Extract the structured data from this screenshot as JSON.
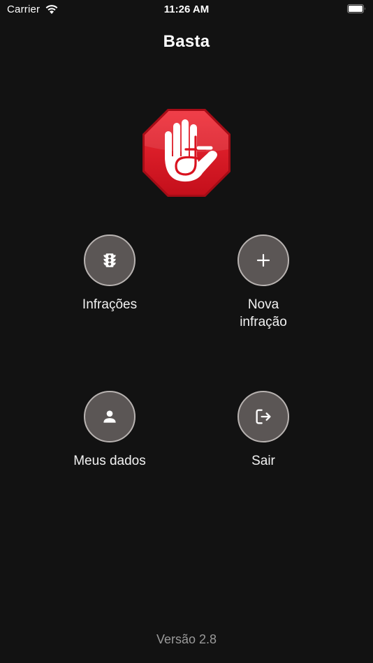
{
  "status_bar": {
    "carrier": "Carrier",
    "time": "11:26 AM"
  },
  "header": {
    "title": "Basta"
  },
  "logo": {
    "icon": "stop-hand-logo",
    "colors": {
      "octagon": "#d9121f",
      "border": "#b00d18",
      "hand": "#ffffff"
    }
  },
  "menu": {
    "items": [
      {
        "label": "Infrações",
        "icon": "traffic-light-icon"
      },
      {
        "label": "Nova infração",
        "icon": "plus-icon"
      },
      {
        "label": "Meus dados",
        "icon": "person-icon"
      },
      {
        "label": "Sair",
        "icon": "logout-icon"
      }
    ],
    "colors": {
      "button_fill": "#5b5655",
      "button_ring": "#b8b3b1"
    }
  },
  "footer": {
    "version": "Versão 2.8"
  },
  "theme": {
    "background": "#121212",
    "text": "#ffffff",
    "muted_text": "#9a9a9a"
  }
}
